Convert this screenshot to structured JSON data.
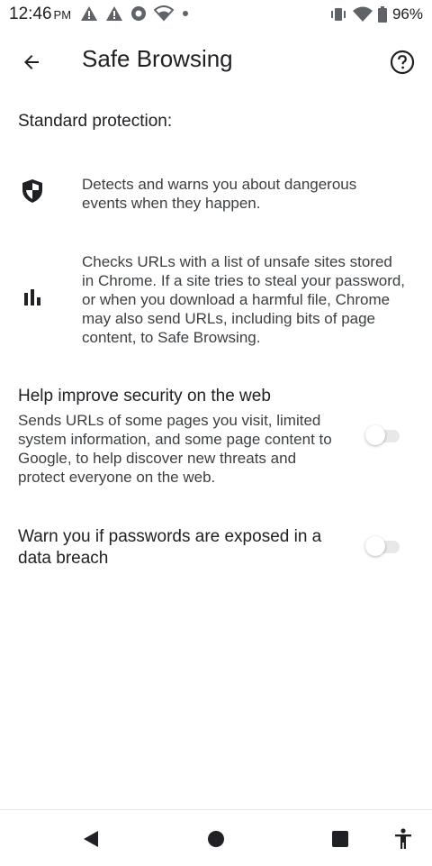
{
  "status_bar": {
    "time": "12:46",
    "ampm": "PM",
    "battery": "96%"
  },
  "app_bar": {
    "title": "Safe Browsing",
    "back_icon": "arrow-back-icon",
    "help_icon": "help-circle-icon"
  },
  "section": {
    "header": "Standard protection:"
  },
  "info_rows": [
    {
      "icon": "shield-icon",
      "text": "Detects and warns you about dangerous events when they happen."
    },
    {
      "icon": "bar-chart-icon",
      "text": "Checks URLs with a list of unsafe sites stored in Chrome. If a site tries to steal your password, or when you download a harmful file, Chrome may also send URLs, including bits of page content, to Safe Browsing."
    }
  ],
  "toggles": [
    {
      "title": "Help improve security on the web",
      "description": "Sends URLs of some pages you visit, limited system information, and some page content to Google, to help discover new threats and protect everyone on the web.",
      "enabled": false
    },
    {
      "title": "Warn you if passwords are exposed in a data breach",
      "description": "",
      "enabled": false
    }
  ],
  "nav_bar": {
    "back": "nav-back-icon",
    "home": "nav-home-icon",
    "recents": "nav-recents-icon",
    "accessibility": "accessibility-icon"
  },
  "colors": {
    "text_primary": "#202124",
    "text_secondary": "#3c4043",
    "icon": "#202124",
    "switch_track_off": "#e8e8e8"
  }
}
